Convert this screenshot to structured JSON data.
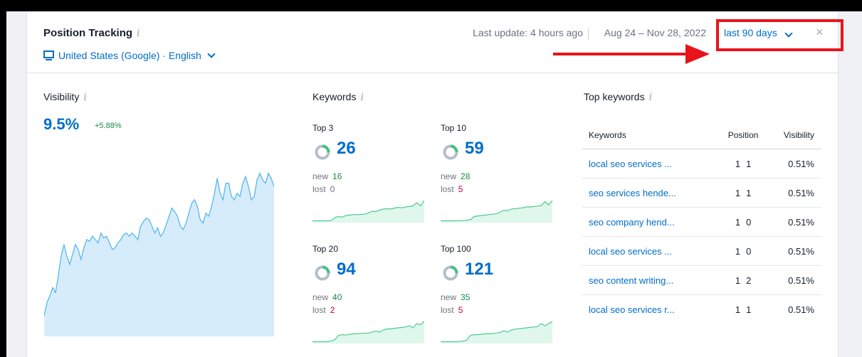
{
  "header": {
    "title": "Position Tracking",
    "info_glyph": "i",
    "location": "United States (Google) · English",
    "last_update": "Last update: 4 hours ago",
    "date_range": "Aug 24 – Nov 28, 2022",
    "period": "last 90 days",
    "close": "×"
  },
  "visibility": {
    "title": "Visibility",
    "value": "9.5%",
    "change": "+5.88%",
    "chart_data": {
      "type": "area",
      "values": [
        0.12,
        0.2,
        0.24,
        0.29,
        0.26,
        0.36,
        0.48,
        0.55,
        0.48,
        0.43,
        0.49,
        0.55,
        0.52,
        0.46,
        0.53,
        0.58,
        0.57,
        0.6,
        0.58,
        0.56,
        0.62,
        0.59,
        0.6,
        0.56,
        0.52,
        0.53,
        0.56,
        0.58,
        0.61,
        0.62,
        0.6,
        0.62,
        0.6,
        0.58,
        0.66,
        0.69,
        0.71,
        0.7,
        0.66,
        0.62,
        0.65,
        0.6,
        0.62,
        0.67,
        0.72,
        0.77,
        0.75,
        0.72,
        0.66,
        0.64,
        0.68,
        0.74,
        0.8,
        0.82,
        0.78,
        0.7,
        0.68,
        0.74,
        0.72,
        0.78,
        0.86,
        0.95,
        0.86,
        0.82,
        0.92,
        0.92,
        0.84,
        0.82,
        0.86,
        0.84,
        0.92,
        0.96,
        0.9,
        0.82,
        0.84,
        0.94,
        0.98,
        0.94,
        0.92,
        0.98,
        0.95,
        0.9
      ]
    }
  },
  "keywords": {
    "title": "Keywords",
    "blocks": [
      {
        "label": "Top 3",
        "value": "26",
        "new_label": "new",
        "new": "16",
        "lost_label": "lost",
        "lost": "0",
        "lost_zero": true,
        "chart_data": {
          "type": "area",
          "values": [
            0.05,
            0.05,
            0.05,
            0.05,
            0.05,
            0.06,
            0.2,
            0.25,
            0.22,
            0.3,
            0.32,
            0.34,
            0.34,
            0.35,
            0.36,
            0.42,
            0.5,
            0.48,
            0.55,
            0.6,
            0.62,
            0.6,
            0.65,
            0.68,
            0.66,
            0.7,
            0.72,
            0.75,
            0.9,
            0.75,
            1.0
          ]
        }
      },
      {
        "label": "Top 10",
        "value": "59",
        "new_label": "new",
        "new": "28",
        "lost_label": "lost",
        "lost": "5",
        "lost_zero": false,
        "chart_data": {
          "type": "area",
          "values": [
            0.05,
            0.05,
            0.05,
            0.05,
            0.05,
            0.06,
            0.06,
            0.08,
            0.1,
            0.25,
            0.28,
            0.3,
            0.32,
            0.34,
            0.36,
            0.38,
            0.45,
            0.55,
            0.52,
            0.6,
            0.62,
            0.64,
            0.66,
            0.7,
            0.7,
            0.72,
            0.74,
            0.76,
            0.95,
            0.8,
            1.0
          ]
        }
      },
      {
        "label": "Top 20",
        "value": "94",
        "new_label": "new",
        "new": "40",
        "lost_label": "lost",
        "lost": "2",
        "lost_zero": false,
        "chart_data": {
          "type": "area",
          "values": [
            0.05,
            0.05,
            0.05,
            0.05,
            0.05,
            0.08,
            0.15,
            0.35,
            0.38,
            0.36,
            0.4,
            0.42,
            0.42,
            0.44,
            0.45,
            0.45,
            0.5,
            0.55,
            0.5,
            0.6,
            0.65,
            0.65,
            0.68,
            0.7,
            0.72,
            0.74,
            0.8,
            0.7,
            0.9,
            0.85,
            1.0
          ]
        }
      },
      {
        "label": "Top 100",
        "value": "121",
        "new_label": "new",
        "new": "35",
        "lost_label": "lost",
        "lost": "5",
        "lost_zero": false,
        "chart_data": {
          "type": "area",
          "values": [
            0.05,
            0.05,
            0.05,
            0.05,
            0.05,
            0.06,
            0.08,
            0.12,
            0.35,
            0.38,
            0.38,
            0.4,
            0.42,
            0.42,
            0.44,
            0.46,
            0.48,
            0.56,
            0.5,
            0.6,
            0.64,
            0.66,
            0.68,
            0.7,
            0.72,
            0.74,
            0.76,
            0.9,
            0.8,
            0.9,
            1.0
          ]
        }
      }
    ]
  },
  "top_keywords": {
    "title": "Top keywords",
    "columns": [
      "Keywords",
      "Position",
      "Visibility"
    ],
    "rows": [
      {
        "keyword": "local seo services ...",
        "pos": "1",
        "change": "1",
        "vis": "0.51%"
      },
      {
        "keyword": "seo services hende...",
        "pos": "1",
        "change": "1",
        "vis": "0.51%"
      },
      {
        "keyword": "seo company hend...",
        "pos": "1",
        "change": "0",
        "vis": "0.51%"
      },
      {
        "keyword": "local seo services ...",
        "pos": "1",
        "change": "0",
        "vis": "0.51%"
      },
      {
        "keyword": "seo content writing...",
        "pos": "1",
        "change": "2",
        "vis": "0.51%"
      },
      {
        "keyword": "local seo services r...",
        "pos": "1",
        "change": "1",
        "vis": "0.51%"
      }
    ]
  },
  "colors": {
    "accent": "#006dca",
    "positive": "#1a8a47",
    "negative": "#d1002f",
    "visibility_fill": "#d6ecfb",
    "visibility_line": "#4cb3ef",
    "spark_fill": "#e0f7ec",
    "spark_line": "#4ccb93",
    "annotation": "#e8141b"
  }
}
